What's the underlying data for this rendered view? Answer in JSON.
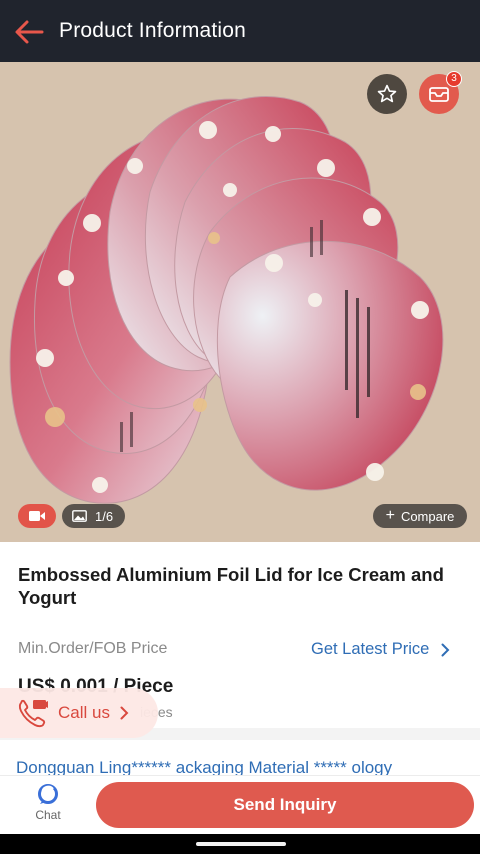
{
  "header": {
    "title": "Product Information"
  },
  "gallery": {
    "image_counter": "1/6",
    "compare_label": "Compare",
    "inbox_badge": "3"
  },
  "product": {
    "title": "Embossed Aluminium Foil Lid for Ice Cream and Yogurt",
    "price_label": "Min.Order/FOB Price",
    "latest_price_link": "Get Latest Price",
    "price_value": "US$ 0.001 / Piece",
    "moq_fragment": "ieces"
  },
  "call": {
    "label": "Call us"
  },
  "supplier": {
    "name": "Dongguan Ling****** ackaging Material ***** ology"
  },
  "bottom": {
    "chat_label": "Chat",
    "inquiry_label": "Send Inquiry"
  },
  "colors": {
    "accent": "#df5a4f",
    "link": "#2f6db5",
    "topbar": "#20242d"
  }
}
